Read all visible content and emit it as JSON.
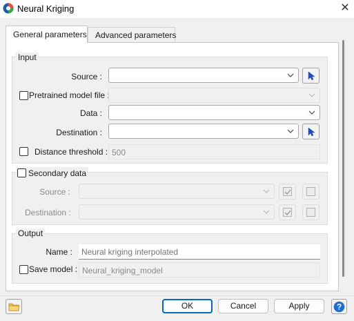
{
  "window": {
    "title": "Neural Kriging",
    "close_symbol": "✕"
  },
  "tabs": [
    {
      "label": "General parameters",
      "active": true
    },
    {
      "label": "Advanced parameters",
      "active": false
    }
  ],
  "input_group": {
    "legend": "Input",
    "source_label": "Source :",
    "pretrained_label": "Pretrained model file :",
    "data_label": "Data :",
    "destination_label": "Destination :",
    "distance_label": "Distance threshold :",
    "distance_value": "500"
  },
  "secondary_group": {
    "legend": "Secondary data",
    "source_label": "Source :",
    "destination_label": "Destination :"
  },
  "output_group": {
    "legend": "Output",
    "name_label": "Name :",
    "name_placeholder": "Neural kriging interpolated",
    "save_model_label": "Save model :",
    "save_model_value": "Neural_kriging_model"
  },
  "footer": {
    "ok_label": "OK",
    "cancel_label": "Cancel",
    "apply_label": "Apply",
    "help_symbol": "?"
  },
  "colors": {
    "accent": "#0067c0",
    "pick_arrow": "#1f4fb8"
  }
}
